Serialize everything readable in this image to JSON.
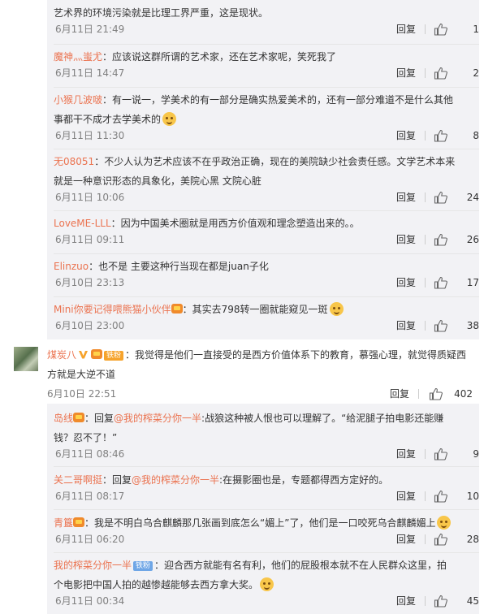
{
  "ui": {
    "reply_label": "回复"
  },
  "replies_top": [
    {
      "text": "艺术界的环境污染就是比理工界严重，这是现状。",
      "time": "6月11日 21:49",
      "likes": "1"
    },
    {
      "user": "魔神灬蚩尤",
      "text": "：应该说这群所谓的艺术家，还在艺术家呢，笑死我了",
      "time": "6月11日 14:47",
      "likes": "2"
    },
    {
      "user": "小猴几波啵",
      "text": "：有一说一，学美术的有一部分是确实热爱美术的，还有一部分难道不是什么其他",
      "text2": "事都干不成才去学美术的",
      "time": "6月11日 11:30",
      "likes": "8"
    },
    {
      "user": "无08051",
      "text": "：不少人认为艺术应该不在乎政治正确，现在的美院缺少社会责任感。文学艺术本来",
      "text2": "就是一种意识形态的具象化，美院心黑 文院心脏",
      "time": "6月11日 10:06",
      "likes": "24"
    },
    {
      "user": "LoveME-LLL",
      "text": "：因为中国美术圈就是用西方价值观和理念塑造出来的。。",
      "time": "6月11日 09:11",
      "likes": "26"
    },
    {
      "user": "Elinzuo",
      "text": "：也不是  主要这种行当现在都是juan子化",
      "time": "6月10日 23:13",
      "likes": "17"
    },
    {
      "user": "Mini你要记得喂熊猫小伙伴",
      "text": "：其实去798转一圈就能窥见一斑",
      "time": "6月10日 23:00",
      "likes": "38"
    }
  ],
  "top_comment": {
    "user": "煤炭八",
    "badge": "铁粉",
    "text": "：我觉得是他们一直接受的是西方价值体系下的教育，慕强心理，就觉得质疑西",
    "text2": "方就是大逆不道",
    "time": "6月10日 22:51",
    "likes": "402"
  },
  "replies_bottom": [
    {
      "user": "岛线",
      "prefix": "：回复",
      "mention": "@我的榨菜分你一半",
      "text": ":战狼这种被人恨也可以理解了。“给泥腿子拍电影还能赚",
      "text2": "钱？忍不了！”",
      "time": "6月11日 08:46",
      "likes": "9"
    },
    {
      "user": "关二哥啊挺",
      "prefix": "：回复",
      "mention": "@我的榨菜分你一半",
      "text": ":在摄影圈也是，专题都得西方定好的。",
      "time": "6月11日 08:17",
      "likes": "10"
    },
    {
      "user": "青簋",
      "text": "：我是不明白乌合麒麟那几张画到底怎么“媚上”了，他们是一口咬死乌合麒麟媚上",
      "time": "6月11日 06:20",
      "likes": "28"
    },
    {
      "user": "我的榨菜分你一半",
      "badge": "铁粉",
      "text": "：迎合西方就能有名有利，他们的屁股根本就不在人民群众这里，拍",
      "text2": "个电影把中国人拍的越惨越能够去西方拿大奖。",
      "time": "6月11日 00:34",
      "likes": "45"
    }
  ]
}
